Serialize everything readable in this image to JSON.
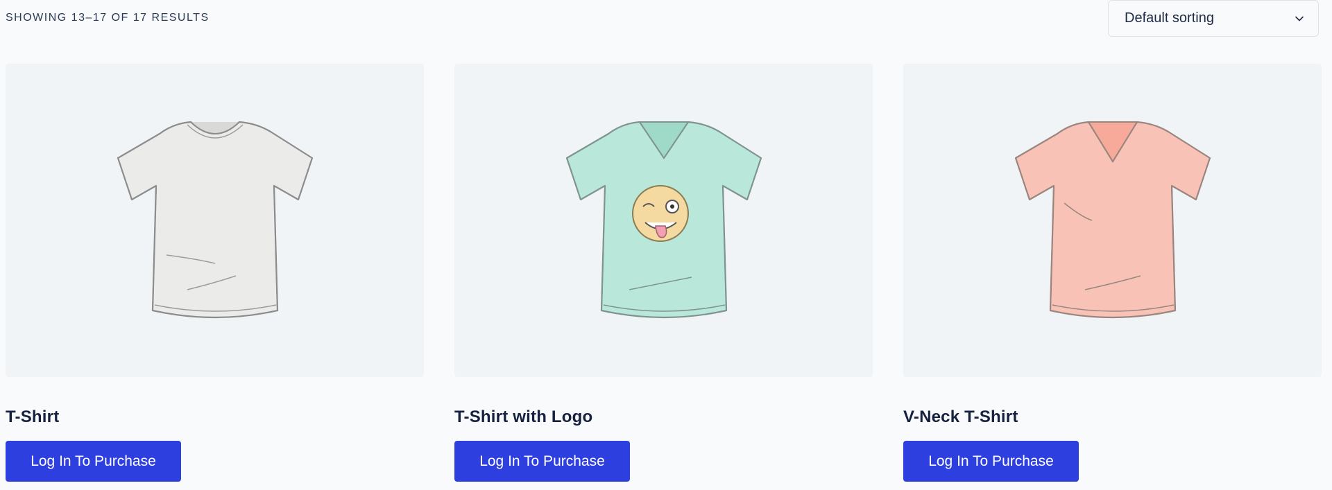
{
  "results": {
    "label": "Showing 13–17 of 17 results"
  },
  "sorting": {
    "selected": "Default sorting",
    "icon": "chevron-down-icon"
  },
  "products": [
    {
      "title": "T-Shirt",
      "button_label": "Log In To Purchase",
      "image": "plain-tshirt-image",
      "shirt_color": "#ebebea",
      "collar": "crew"
    },
    {
      "title": "T-Shirt with Logo",
      "button_label": "Log In To Purchase",
      "image": "tshirt-with-logo-image",
      "shirt_color": "#b9e8da",
      "collar": "v-neck",
      "logo_color": "#f4d9a0"
    },
    {
      "title": "V-Neck T-Shirt",
      "button_label": "Log In To Purchase",
      "image": "vneck-tshirt-image",
      "shirt_color": "#f8c3b6",
      "collar": "v-neck"
    }
  ],
  "colors": {
    "accent": "#2e3fe0",
    "image_background": "#f0f4f7",
    "page_background": "#f8fafc"
  }
}
